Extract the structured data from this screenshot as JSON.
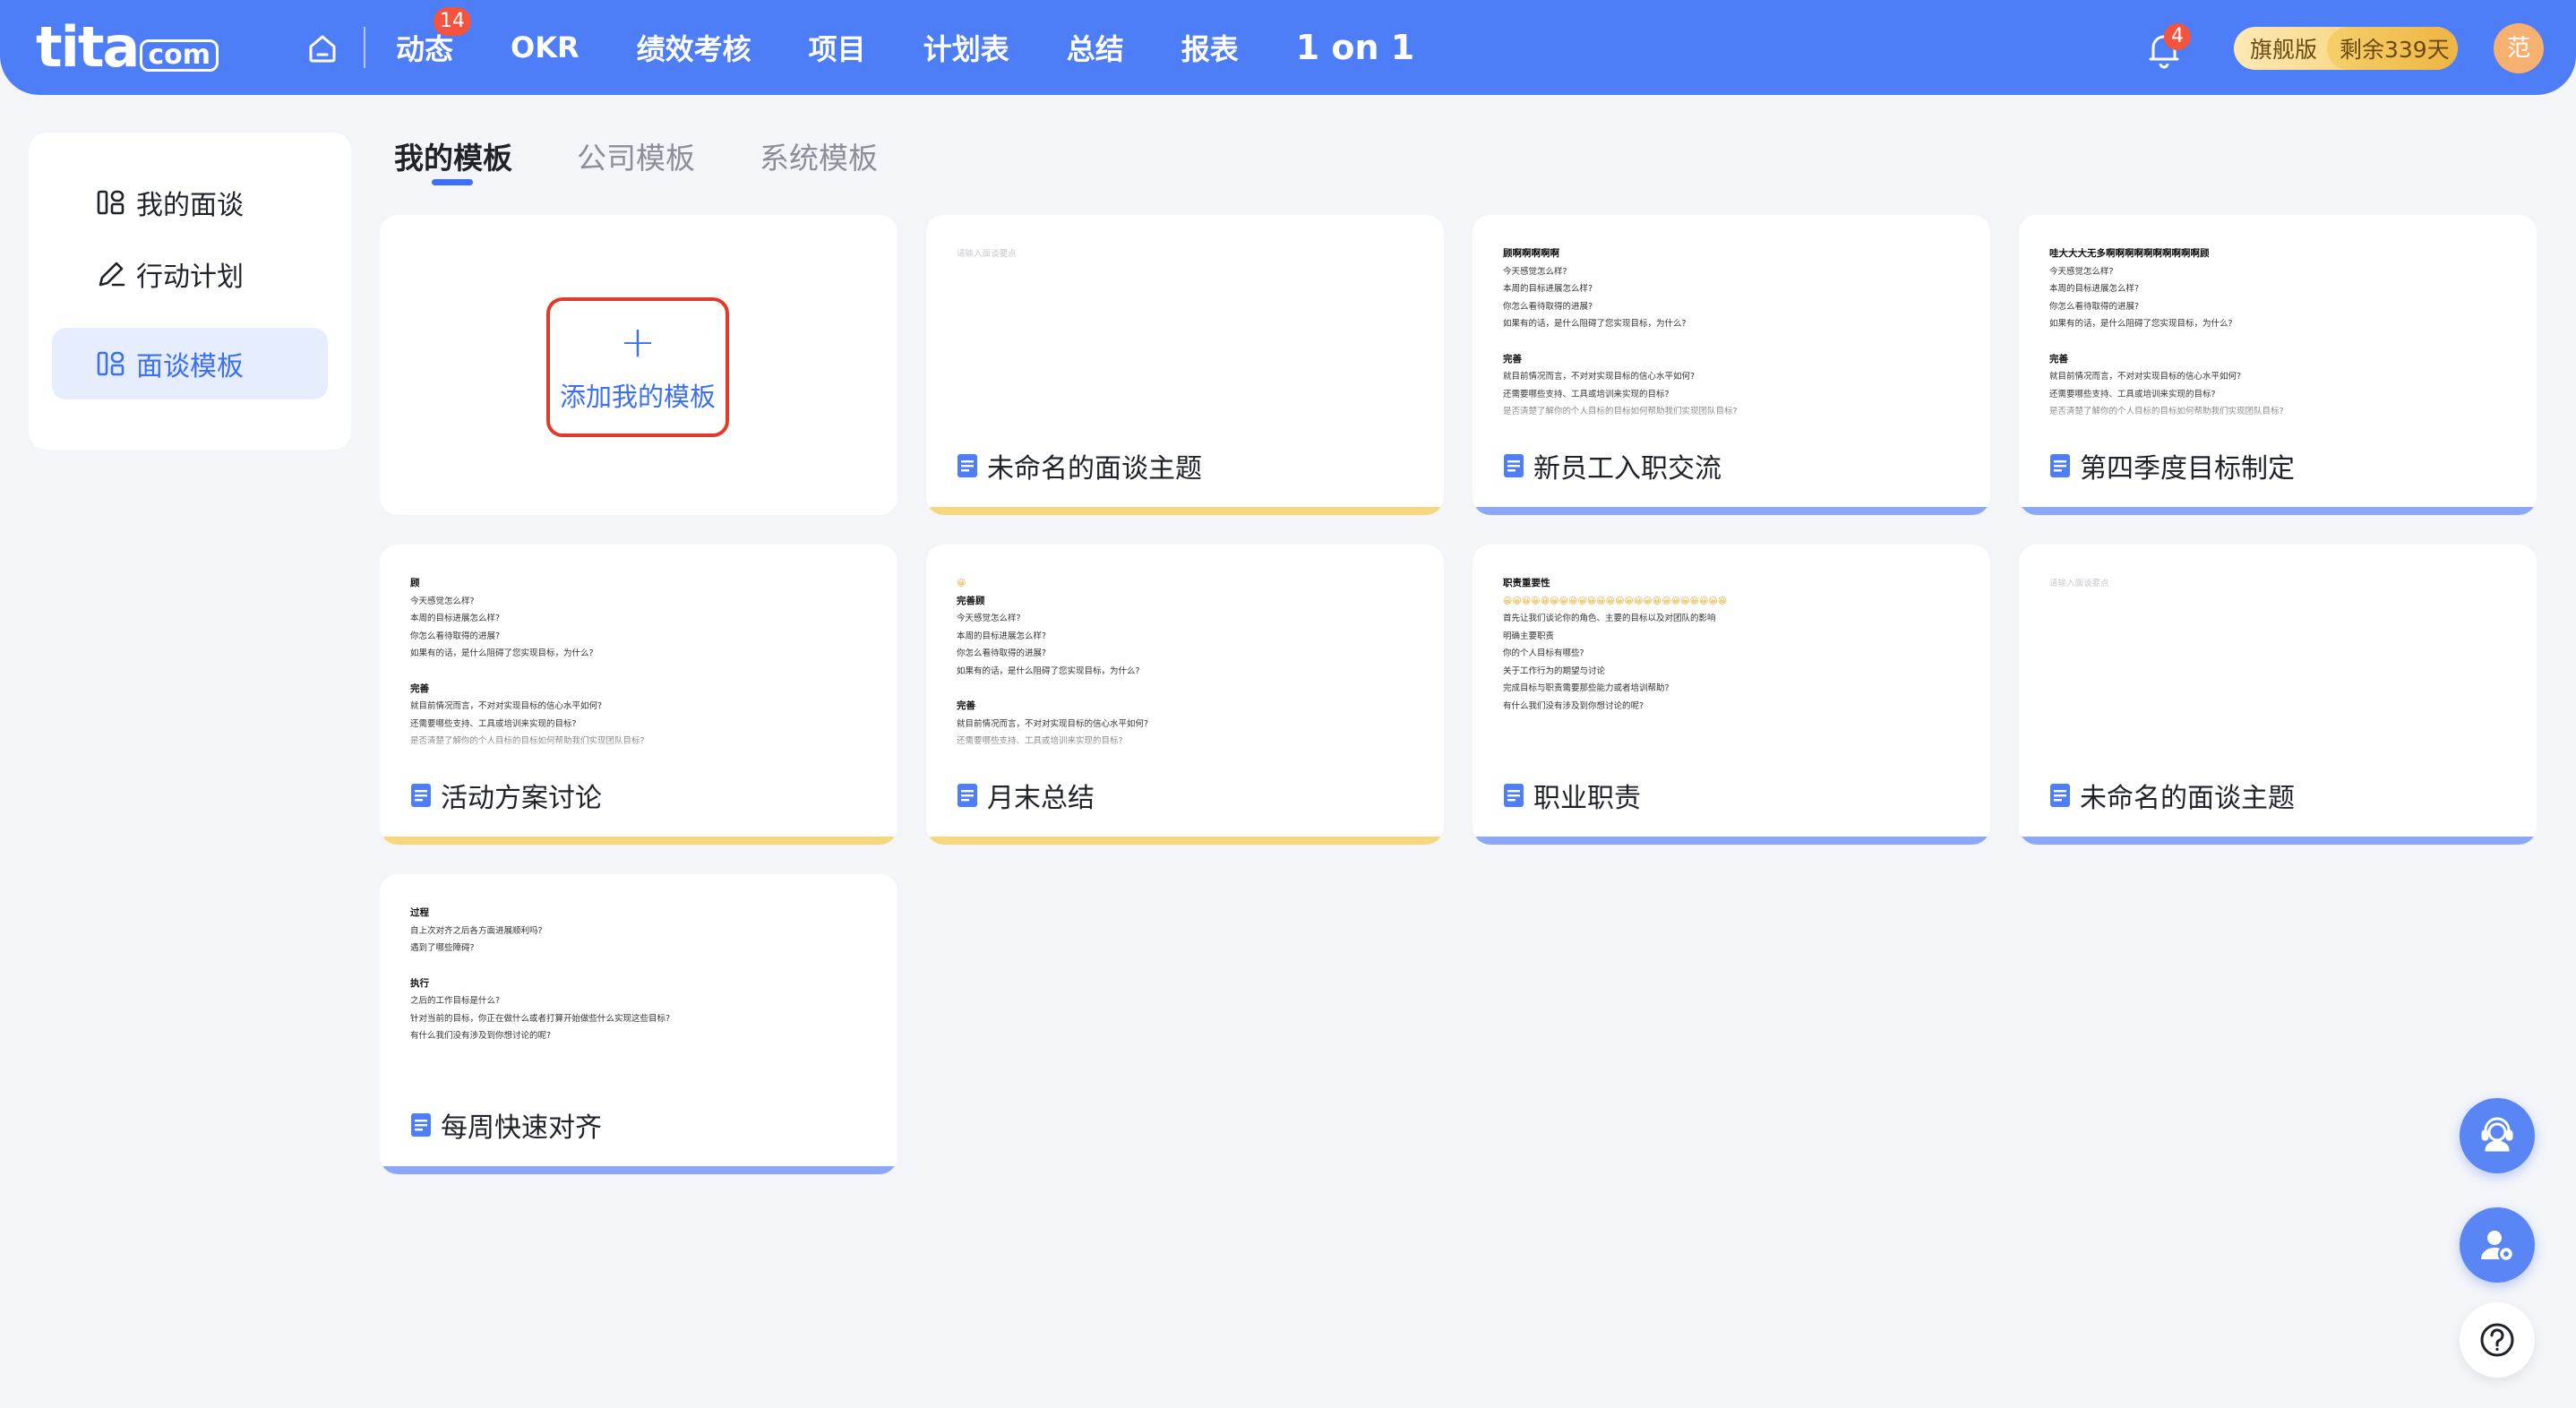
{
  "brand": {
    "logo_main": "tita",
    "logo_domain": "com"
  },
  "nav": {
    "items": [
      {
        "label": "动态",
        "badge": "14"
      },
      {
        "label": "OKR"
      },
      {
        "label": "绩效考核"
      },
      {
        "label": "项目"
      },
      {
        "label": "计划表"
      },
      {
        "label": "总结"
      },
      {
        "label": "报表"
      },
      {
        "label": "1 on 1"
      }
    ],
    "notification_badge": "4",
    "plan_version": "旗舰版",
    "plan_remaining": "剩余339天",
    "avatar_text": "范"
  },
  "sidebar": {
    "items": [
      {
        "label": "我的面谈"
      },
      {
        "label": "行动计划"
      },
      {
        "label": "面谈模板"
      }
    ]
  },
  "tabs": [
    {
      "label": "我的模板"
    },
    {
      "label": "公司模板"
    },
    {
      "label": "系统模板"
    }
  ],
  "add_card": {
    "label": "添加我的模板"
  },
  "cards": [
    {
      "title": "未命名的面谈主题",
      "preview": [
        {
          "ph": "请输入面谈要点"
        }
      ]
    },
    {
      "title": "新员工入职交流",
      "preview": [
        {
          "h": "顾啊啊啊啊啊"
        },
        {
          "t": "今天感觉怎么样?"
        },
        {
          "t": "本周的目标进展怎么样?"
        },
        {
          "t": "你怎么看待取得的进展?"
        },
        {
          "t": "如果有的话，是什么阻碍了您实现目标，为什么?"
        },
        {
          "gap": true
        },
        {
          "h": "完善"
        },
        {
          "t": "就目前情况而言，不对对实现目标的信心水平如何?"
        },
        {
          "t": "还需要哪些支持、工具或培训来实现的目标?"
        },
        {
          "t": "是否清楚了解你的个人目标的目标如何帮助我们实现团队目标?"
        }
      ]
    },
    {
      "title": "第四季度目标制定",
      "preview": [
        {
          "h": "哇大大大无多啊啊啊啊啊啊啊啊啊啊顾"
        },
        {
          "t": "今天感觉怎么样?"
        },
        {
          "t": "本周的目标进展怎么样?"
        },
        {
          "t": "你怎么看待取得的进展?"
        },
        {
          "t": "如果有的话，是什么阻碍了您实现目标，为什么?"
        },
        {
          "gap": true
        },
        {
          "h": "完善"
        },
        {
          "t": "就目前情况而言，不对对实现目标的信心水平如何?"
        },
        {
          "t": "还需要哪些支持、工具或培训来实现的目标?"
        },
        {
          "t": "是否清楚了解你的个人目标的目标如何帮助我们实现团队目标?"
        }
      ]
    },
    {
      "title": "活动方案讨论",
      "preview": [
        {
          "h": "顾"
        },
        {
          "t": "今天感觉怎么样?"
        },
        {
          "t": "本周的目标进展怎么样?"
        },
        {
          "t": "你怎么看待取得的进展?"
        },
        {
          "t": "如果有的话，是什么阻碍了您实现目标，为什么?"
        },
        {
          "gap": true
        },
        {
          "h": "完善"
        },
        {
          "t": "就目前情况而言，不对对实现目标的信心水平如何?"
        },
        {
          "t": "还需要哪些支持、工具或培训来实现的目标?"
        },
        {
          "t": "是否清楚了解你的个人目标的目标如何帮助我们实现团队目标?"
        }
      ]
    },
    {
      "title": "月末总结",
      "preview": [
        {
          "emoji": "😀"
        },
        {
          "h": "完善顾"
        },
        {
          "t": "今天感觉怎么样?"
        },
        {
          "t": "本周的目标进展怎么样?"
        },
        {
          "t": "你怎么看待取得的进展?"
        },
        {
          "t": "如果有的话，是什么阻碍了您实现目标，为什么?"
        },
        {
          "gap": true
        },
        {
          "h": "完善"
        },
        {
          "t": "就目前情况而言，不对对实现目标的信心水平如何?"
        },
        {
          "t": "还需要哪些支持、工具或培训来实现的目标?"
        }
      ]
    },
    {
      "title": "职业职责",
      "preview": [
        {
          "h": "职责重要性"
        },
        {
          "emoji": "😀😀😀😀😀😀😀😀😀😀😀😀😀😀😀😀😀😀😀😀😀😀😀😀"
        },
        {
          "t": "首先让我们谈论你的角色、主要的目标以及对团队的影响"
        },
        {
          "t": "明确主要职责"
        },
        {
          "t": "你的个人目标有哪些?"
        },
        {
          "t": "关于工作行为的期望与讨论"
        },
        {
          "t": "完成目标与职责需要那些能力或者培训帮助?"
        },
        {
          "t": "有什么我们没有涉及到你想讨论的呢?"
        }
      ]
    },
    {
      "title": "未命名的面谈主题",
      "preview": [
        {
          "ph": "请输入面谈要点"
        }
      ]
    },
    {
      "title": "每周快速对齐",
      "preview": [
        {
          "h": "过程"
        },
        {
          "t": "自上次对齐之后各方面进展顺利吗?"
        },
        {
          "t": "遇到了哪些障碍?"
        },
        {
          "gap": true
        },
        {
          "h": "执行"
        },
        {
          "t": "之后的工作目标是什么?"
        },
        {
          "t": "针对当前的目标，你正在做什么或者打算开始做些什么实现这些目标?"
        },
        {
          "t": "有什么我们没有涉及到你想讨论的呢?"
        }
      ]
    }
  ],
  "colors": {
    "nav_bg": "#4e7ef7",
    "accent": "#3b6ff5",
    "stripe_yellow": "#f6d77e",
    "stripe_blue": "#8ba8f6",
    "badge_red": "#f5533d",
    "add_border": "#e23a2a"
  },
  "icons": {
    "home": "home-icon",
    "bell": "bell-icon",
    "meeting": "meeting-icon",
    "action": "pen-icon",
    "template": "template-icon",
    "doc": "document-icon",
    "support": "customer-service-icon",
    "user_settings": "user-settings-icon",
    "help": "help-icon"
  }
}
